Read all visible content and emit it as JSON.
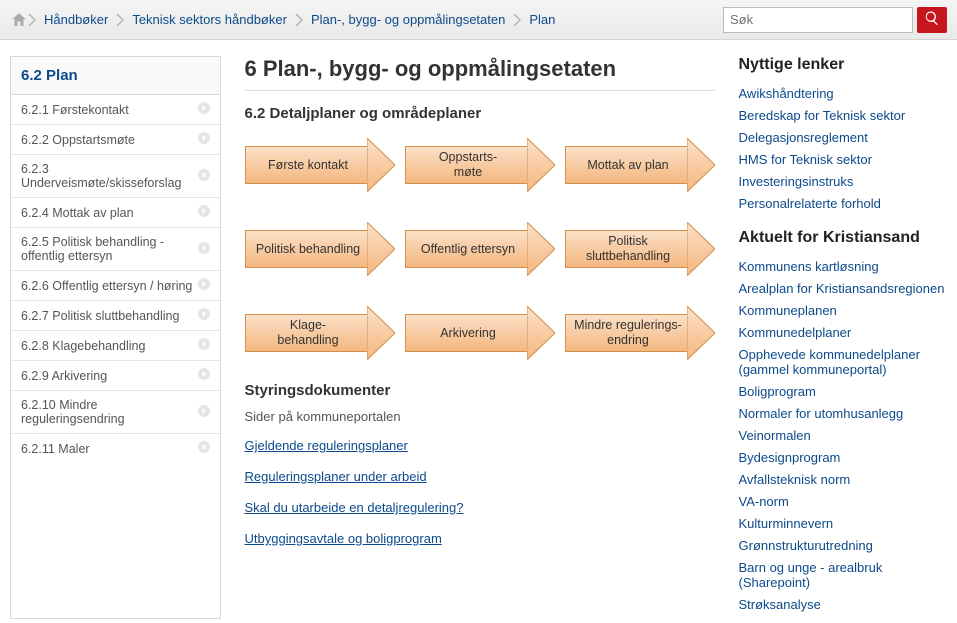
{
  "search": {
    "placeholder": "Søk"
  },
  "breadcrumbs": {
    "items": [
      {
        "label": "Håndbøker"
      },
      {
        "label": "Teknisk sektors håndbøker"
      },
      {
        "label": "Plan-, bygg- og oppmålingsetaten"
      },
      {
        "label": "Plan"
      }
    ]
  },
  "leftnav": {
    "header": "6.2 Plan",
    "items": [
      {
        "label": "6.2.1 Førstekontakt"
      },
      {
        "label": "6.2.2 Oppstartsmøte"
      },
      {
        "label": "6.2.3 Underveismøte/skisseforslag"
      },
      {
        "label": "6.2.4 Mottak av plan"
      },
      {
        "label": "6.2.5 Politisk behandling - offentlig ettersyn"
      },
      {
        "label": "6.2.6 Offentlig ettersyn / høring"
      },
      {
        "label": "6.2.7 Politisk sluttbehandling"
      },
      {
        "label": "6.2.8 Klagebehandling"
      },
      {
        "label": "6.2.9 Arkivering"
      },
      {
        "label": "6.2.10 Mindre reguleringsendring"
      },
      {
        "label": "6.2.11 Maler"
      }
    ]
  },
  "main": {
    "title": "6 Plan-, bygg- og oppmålingsetaten",
    "subtitle": "6.2 Detaljplaner og områdeplaner",
    "flow": [
      {
        "label": "Første kontakt"
      },
      {
        "label": "Oppstarts-\nmøte"
      },
      {
        "label": "Mottak av plan"
      },
      {
        "label": "Politisk behandling"
      },
      {
        "label": "Offentlig ettersyn"
      },
      {
        "label": "Politisk sluttbehandling"
      },
      {
        "label": "Klage-\nbehandling"
      },
      {
        "label": "Arkivering"
      },
      {
        "label": "Mindre regulerings-\nendring"
      }
    ],
    "docs_heading": "Styringsdokumenter",
    "docs_sub": "Sider på kommuneportalen",
    "doclinks": [
      {
        "label": "Gjeldende reguleringsplaner"
      },
      {
        "label": "Reguleringsplaner under arbeid"
      },
      {
        "label": "Skal du utarbeide en detaljregulering?"
      },
      {
        "label": "Utbyggingsavtale og boligprogram"
      }
    ]
  },
  "rightcol": {
    "heading1": "Nyttige lenker",
    "links1": [
      {
        "label": "Awikshåndtering"
      },
      {
        "label": "Beredskap for Teknisk sektor"
      },
      {
        "label": "Delegasjonsreglement"
      },
      {
        "label": "HMS for Teknisk sektor"
      },
      {
        "label": "Investeringsinstruks"
      },
      {
        "label": "Personalrelaterte forhold"
      }
    ],
    "heading2": "Aktuelt for Kristiansand",
    "links2": [
      {
        "label": "Kommunens kartløsning"
      },
      {
        "label": "Arealplan for Kristiansandsregionen"
      },
      {
        "label": "Kommuneplanen"
      },
      {
        "label": "Kommunedelplaner"
      },
      {
        "label": "Opphevede kommunedelplaner (gammel kommuneportal)"
      },
      {
        "label": "Boligprogram"
      },
      {
        "label": "Normaler for utomhusanlegg"
      },
      {
        "label": "Veinormalen"
      },
      {
        "label": "Bydesignprogram"
      },
      {
        "label": "Avfallsteknisk norm"
      },
      {
        "label": "VA-norm"
      },
      {
        "label": "Kulturminnevern"
      },
      {
        "label": "Grønnstrukturutredning"
      },
      {
        "label": "Barn og unge - arealbruk (Sharepoint)"
      },
      {
        "label": "Strøksanalyse"
      }
    ]
  }
}
